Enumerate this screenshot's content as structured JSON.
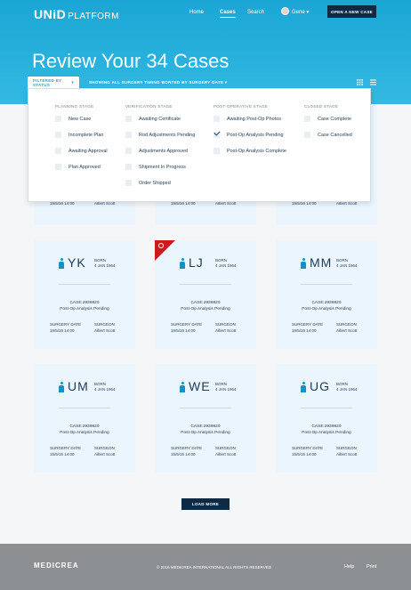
{
  "header": {
    "logo_main": "UNiD",
    "logo_sub": "PLATFORM",
    "nav": [
      "Home",
      "Cases",
      "Search"
    ],
    "user": "Gene",
    "open_case": "OPEN A NEW CASE"
  },
  "page": {
    "title": "Review Your 34 Cases"
  },
  "filters": {
    "status": "FILTERED BY STATUS",
    "timing": "SHOWING ALL SURGERY TIMING",
    "sort": "SORTED BY SURGERY DATE"
  },
  "status_panel": {
    "columns": [
      {
        "title": "PLANNING STAGE",
        "options": [
          {
            "label": "New Case",
            "checked": false
          },
          {
            "label": "Incomplete Plan",
            "checked": false
          },
          {
            "label": "Awaiting Approval",
            "checked": false
          },
          {
            "label": "Plan Approved",
            "checked": false
          }
        ]
      },
      {
        "title": "VERIFICATION STAGE",
        "options": [
          {
            "label": "Awaiting Certificate",
            "checked": false
          },
          {
            "label": "Rod Adjustments Pending",
            "checked": false
          },
          {
            "label": "Adjustments Approved",
            "checked": false
          },
          {
            "label": "Shipment In Progress",
            "checked": false
          },
          {
            "label": "Order Shipped",
            "checked": false
          }
        ]
      },
      {
        "title": "POST-OPERATIVE STAGE",
        "options": [
          {
            "label": "Awaiting Post-Op Photos",
            "checked": false
          },
          {
            "label": "Post-Op Analysis Pending",
            "checked": true
          },
          {
            "label": "Post-Op Analysis Complete",
            "checked": false
          }
        ]
      },
      {
        "title": "CLOSED STAGE",
        "options": [
          {
            "label": "Case Complete",
            "checked": false
          },
          {
            "label": "Case Cancelled",
            "checked": false
          }
        ]
      }
    ]
  },
  "top_cards": [
    {
      "date": "15/5/16 14:00",
      "surgeon": "Albert Scott"
    },
    {
      "date": "15/5/16 14:00",
      "surgeon": "Albert Scott"
    },
    {
      "date": "15/5/16 14:00",
      "surgeon": "Albert Scott"
    }
  ],
  "cards": [
    {
      "initials": "YK",
      "born_label": "BORN",
      "born": "4 JAN 1964",
      "case": "CASE 2939820",
      "status": "Post-Op Analysis Pending",
      "date_label": "SURGERY DATE",
      "date": "15/5/16 14:00",
      "surgeon_label": "SURGEON",
      "surgeon": "Albert Scott",
      "alarm": false
    },
    {
      "initials": "LJ",
      "born_label": "BORN",
      "born": "4 JAN 1964",
      "case": "CASE 2939820",
      "status": "Post-Op Analysis Pending",
      "date_label": "SURGERY DATE",
      "date": "15/5/16 14:00",
      "surgeon_label": "SURGEON",
      "surgeon": "Albert Scott",
      "alarm": true
    },
    {
      "initials": "MM",
      "born_label": "BORN",
      "born": "4 JAN 1964",
      "case": "CASE 2939820",
      "status": "Post-Op Analysis Pending",
      "date_label": "SURGERY DATE",
      "date": "15/5/16 14:00",
      "surgeon_label": "SURGEON",
      "surgeon": "Albert Scott",
      "alarm": false
    },
    {
      "initials": "UM",
      "born_label": "BORN",
      "born": "4 JAN 1964",
      "case": "CASE 2939820",
      "status": "Post-Op Analysis Pending",
      "date_label": "SURGERY DATE",
      "date": "15/5/16 14:00",
      "surgeon_label": "SURGEON",
      "surgeon": "Albert Scott",
      "alarm": false
    },
    {
      "initials": "WE",
      "born_label": "BORN",
      "born": "4 JAN 1964",
      "case": "CASE 2939820",
      "status": "Post-Op Analysis Pending",
      "date_label": "SURGERY DATE",
      "date": "15/5/16 14:00",
      "surgeon_label": "SURGEON",
      "surgeon": "Albert Scott",
      "alarm": false
    },
    {
      "initials": "UG",
      "born_label": "BORN",
      "born": "4 JAN 1964",
      "case": "CASE 2939820",
      "status": "Post-Op Analysis Pending",
      "date_label": "SURGERY DATE",
      "date": "15/5/16 14:00",
      "surgeon_label": "SURGEON",
      "surgeon": "Albert Scott",
      "alarm": false
    }
  ],
  "load_more": "LOAD MORE",
  "footer": {
    "logo": "MEDICREA",
    "copyright": "© 2016 MEDICREA INTERNATIONAL ALL RIGHTS RESERVED",
    "links": [
      "Help",
      "Print"
    ]
  },
  "colors": {
    "accent": "#1aa6d4",
    "navy": "#0e2a44",
    "card": "#eaf5fd",
    "alarm": "#d0191f"
  }
}
